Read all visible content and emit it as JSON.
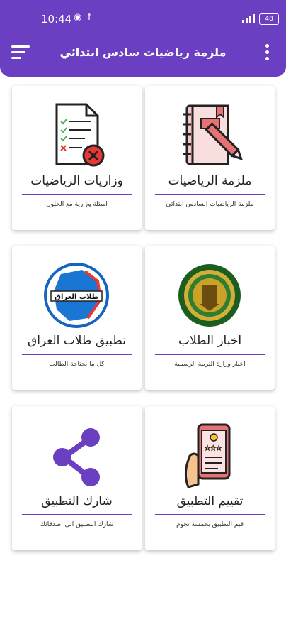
{
  "status_bar": {
    "time": "10:44",
    "battery": "48"
  },
  "app_bar": {
    "title": "ملزمة رياضيات سادس ابتدائي"
  },
  "cards": [
    {
      "title": "ملزمة الرياضيات",
      "subtitle": "ملزمة الرياضيات السادس ابتدائي",
      "icon": "notebook-pencil-icon"
    },
    {
      "title": "وزاريات الرياضيات",
      "subtitle": "اسئلة وزارية مع الحلول",
      "icon": "checklist-document-icon"
    },
    {
      "title": "اخبار الطلاب",
      "subtitle": "اخبار وزارة التربية الرسمية",
      "icon": "ministry-emblem-icon"
    },
    {
      "title": "تطبيق طلاب العراق",
      "subtitle": "كل ما يحتاجة الطالب",
      "icon": "iraq-map-logo-icon"
    },
    {
      "title": "تقييم التطبيق",
      "subtitle": "قيم التطبيق بخمسة نجوم",
      "icon": "phone-rating-icon"
    },
    {
      "title": "شارك التطبيق",
      "subtitle": "شارك التطبيق الى اصدقائك",
      "icon": "share-icon"
    }
  ],
  "iraq_logo_text": "طلاب العراق",
  "colors": {
    "primary": "#6a3fc1",
    "accent_red": "#e53935"
  }
}
